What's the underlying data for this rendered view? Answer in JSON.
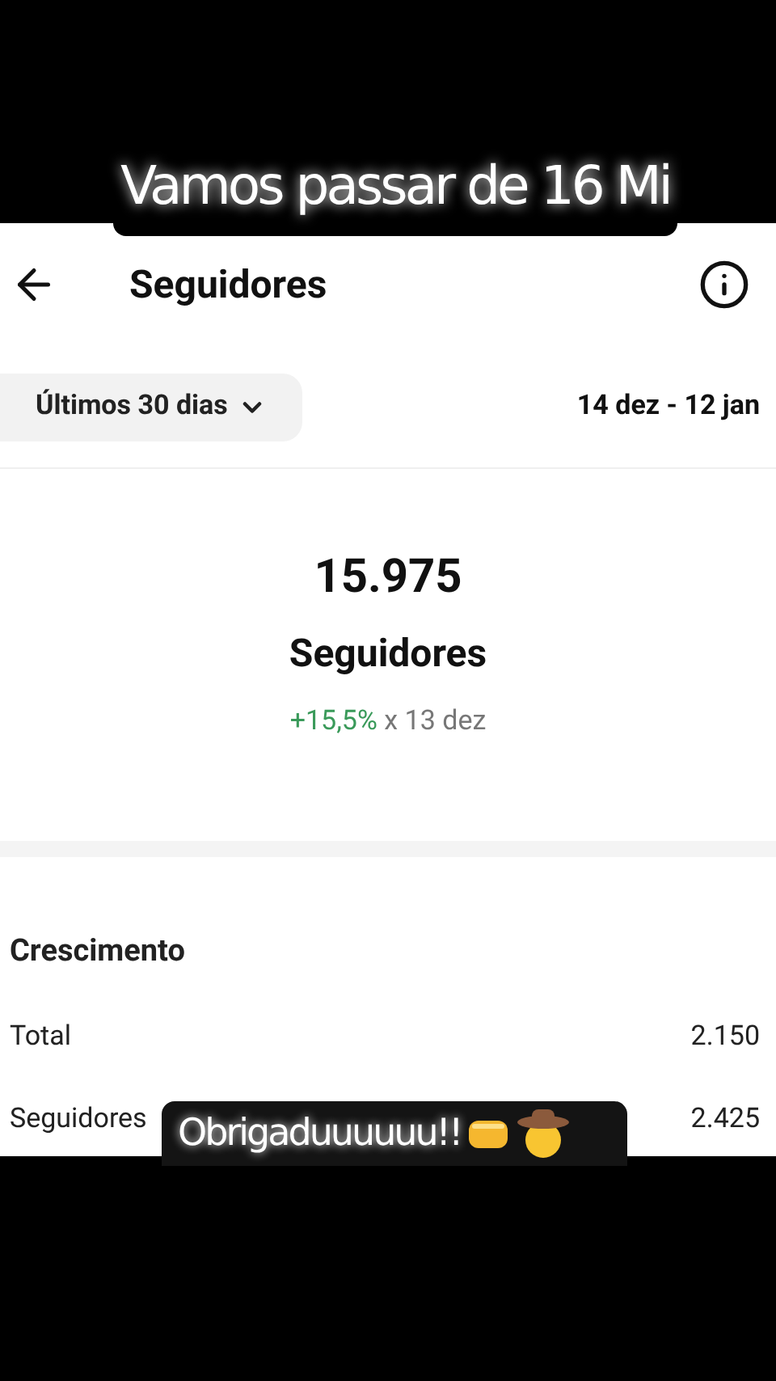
{
  "captions": [
    {
      "text": "Vamos passar de 16 Mi",
      "kind": "top"
    },
    {
      "text": "Obrigaduuuuuu!!",
      "kind": "bottom"
    }
  ],
  "header": {
    "title": "Seguidores"
  },
  "filter": {
    "label": "Últimos 30 dias",
    "date_range": "14 dez - 12 jan"
  },
  "summary": {
    "value": "15.975",
    "label": "Seguidores",
    "change": "+15,5%",
    "comparison": "x 13 dez"
  },
  "growth": {
    "title": "Crescimento",
    "rows": [
      {
        "label": "Total",
        "value": "2.150"
      },
      {
        "label": "Seguidores",
        "value": "2.425"
      }
    ]
  }
}
